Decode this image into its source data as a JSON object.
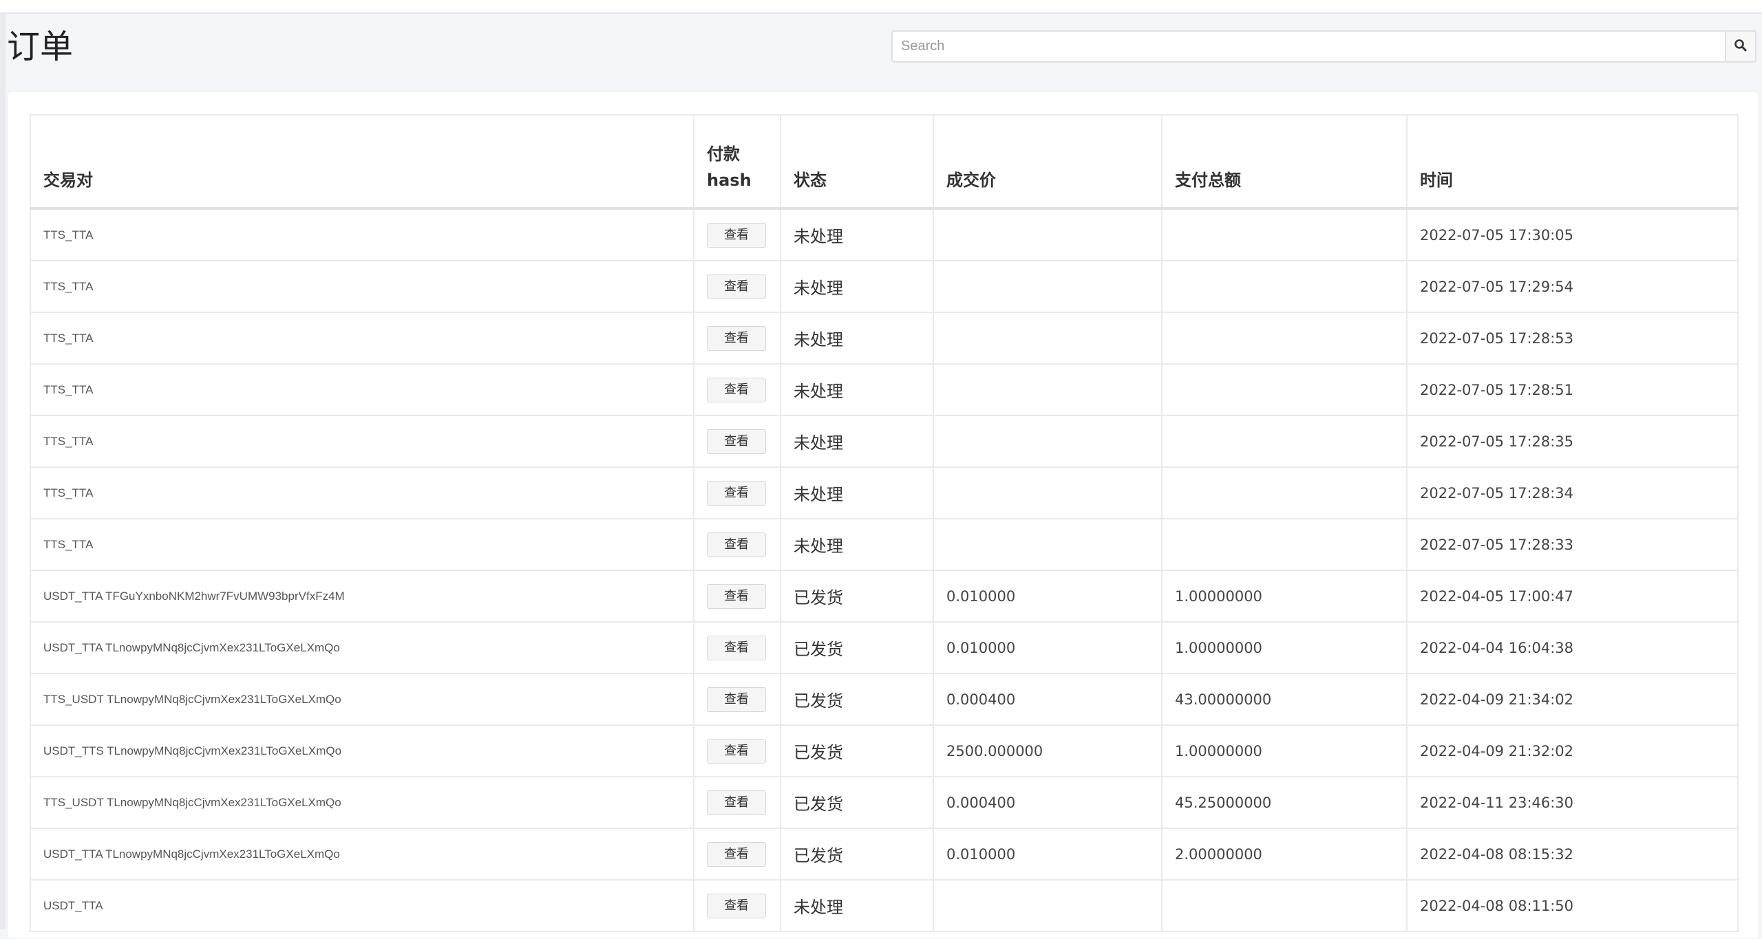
{
  "page": {
    "title": "订单"
  },
  "search": {
    "placeholder": "Search",
    "icon": "search-icon"
  },
  "table": {
    "headers": [
      "交易对",
      "付款",
      "hash",
      "状态",
      "成交价",
      "支付总额",
      "时间"
    ],
    "rows": [
      {
        "pair": "TTS_TTA",
        "view": "查看",
        "status": "未处理",
        "price": "",
        "total": "",
        "time": "2022-07-05 17:30:05"
      },
      {
        "pair": "TTS_TTA",
        "view": "查看",
        "status": "未处理",
        "price": "",
        "total": "",
        "time": "2022-07-05 17:29:54"
      },
      {
        "pair": "TTS_TTA",
        "view": "查看",
        "status": "未处理",
        "price": "",
        "total": "",
        "time": "2022-07-05 17:28:53"
      },
      {
        "pair": "TTS_TTA",
        "view": "查看",
        "status": "未处理",
        "price": "",
        "total": "",
        "time": "2022-07-05 17:28:51"
      },
      {
        "pair": "TTS_TTA",
        "view": "查看",
        "status": "未处理",
        "price": "",
        "total": "",
        "time": "2022-07-05 17:28:35"
      },
      {
        "pair": "TTS_TTA",
        "view": "查看",
        "status": "未处理",
        "price": "",
        "total": "",
        "time": "2022-07-05 17:28:34"
      },
      {
        "pair": "TTS_TTA",
        "view": "查看",
        "status": "未处理",
        "price": "",
        "total": "",
        "time": "2022-07-05 17:28:33"
      },
      {
        "pair": "USDT_TTA TFGuYxnboNKM2hwr7FvUMW93bprVfxFz4M",
        "view": "查看",
        "status": "已发货",
        "price": "0.010000",
        "total": "1.00000000",
        "time": "2022-04-05 17:00:47"
      },
      {
        "pair": "USDT_TTA TLnowpyMNq8jcCjvmXex231LToGXeLXmQo",
        "view": "查看",
        "status": "已发货",
        "price": "0.010000",
        "total": "1.00000000",
        "time": "2022-04-04 16:04:38"
      },
      {
        "pair": "TTS_USDT TLnowpyMNq8jcCjvmXex231LToGXeLXmQo",
        "view": "查看",
        "status": "已发货",
        "price": "0.000400",
        "total": "43.00000000",
        "time": "2022-04-09 21:34:02"
      },
      {
        "pair": "USDT_TTS TLnowpyMNq8jcCjvmXex231LToGXeLXmQo",
        "view": "查看",
        "status": "已发货",
        "price": "2500.000000",
        "total": "1.00000000",
        "time": "2022-04-09 21:32:02"
      },
      {
        "pair": "TTS_USDT TLnowpyMNq8jcCjvmXex231LToGXeLXmQo",
        "view": "查看",
        "status": "已发货",
        "price": "0.000400",
        "total": "45.25000000",
        "time": "2022-04-11 23:46:30"
      },
      {
        "pair": "USDT_TTA TLnowpyMNq8jcCjvmXex231LToGXeLXmQo",
        "view": "查看",
        "status": "已发货",
        "price": "0.010000",
        "total": "2.00000000",
        "time": "2022-04-08 08:15:32"
      },
      {
        "pair": "USDT_TTA",
        "view": "查看",
        "status": "未处理",
        "price": "",
        "total": "",
        "time": "2022-04-08 08:11:50"
      }
    ]
  }
}
